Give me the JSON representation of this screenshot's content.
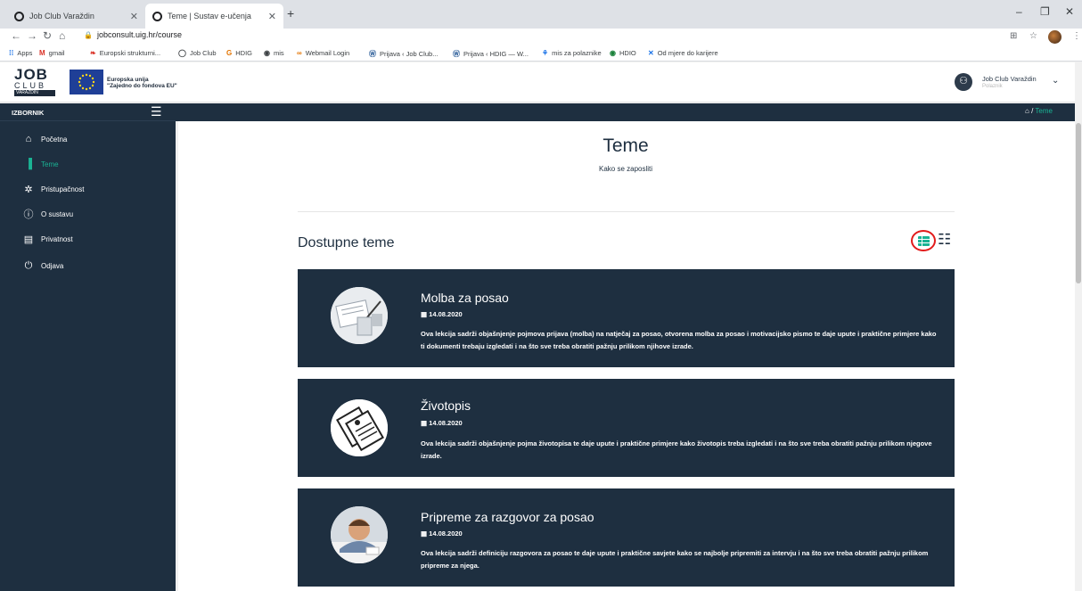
{
  "browser": {
    "tabs": [
      {
        "title": "Job Club Varaždin"
      },
      {
        "title": "Teme | Sustav e-učenja"
      }
    ],
    "url": "jobconsult.uig.hr/course",
    "bookmarks": [
      "Apps",
      "gmail",
      "Europski strukturni...",
      "Job Club",
      "HDIG",
      "mis",
      "Webmail Login",
      "Prijava ‹ Job Club...",
      "Prijava ‹ HDIG — W...",
      "mis za polaznike",
      "HDIO",
      "Od mjere do karijere"
    ]
  },
  "header": {
    "logo_job": "JOB",
    "logo_club": "CLUB",
    "logo_city": "VARAŽDIN",
    "eu_line1": "Europska unija",
    "eu_line2": "\"Zajedno do fondova EU\"",
    "user_name": "Job Club Varaždin",
    "user_role": "Polaznik"
  },
  "sidebar": {
    "title": "IZBORNIK",
    "items": [
      {
        "label": "Početna",
        "icon": "home-icon"
      },
      {
        "label": "Teme",
        "icon": "files-icon"
      },
      {
        "label": "Pristupačnost",
        "icon": "gear-icon"
      },
      {
        "label": "O sustavu",
        "icon": "info-icon"
      },
      {
        "label": "Privatnost",
        "icon": "document-icon"
      },
      {
        "label": "Odjava",
        "icon": "power-icon"
      }
    ]
  },
  "breadcrumb": {
    "sep": "/",
    "current": "Teme"
  },
  "page": {
    "title": "Teme",
    "subtitle": "Kako se zaposliti",
    "section_title": "Dostupne teme"
  },
  "cards": [
    {
      "title": "Molba za posao",
      "date": "14.08.2020",
      "description": "Ova lekcija sadrži objašnjenje pojmova prijava (molba) na natječaj za posao, otvorena molba za posao i motivacijsko pismo te daje upute i praktične primjere kako ti dokumenti trebaju izgledati i na što sve treba obratiti pažnju prilikom njihove izrade."
    },
    {
      "title": "Životopis",
      "date": "14.08.2020",
      "description": "Ova lekcija sadrži objašnjenje pojma životopisa te daje upute i praktične primjere kako životopis treba izgledati i na što sve treba obratiti pažnju prilikom njegove izrade."
    },
    {
      "title": "Pripreme za razgovor za posao",
      "date": "14.08.2020",
      "description": "Ova lekcija sadrži definiciju razgovora za posao te daje upute i praktične savjete kako se najbolje pripremiti za intervju i na što sve treba obratiti pažnju prilikom pripreme za njega."
    }
  ],
  "colors": {
    "accent": "#1ab394",
    "panel": "#1e2f40",
    "highlight_circle": "#e21b1b"
  }
}
